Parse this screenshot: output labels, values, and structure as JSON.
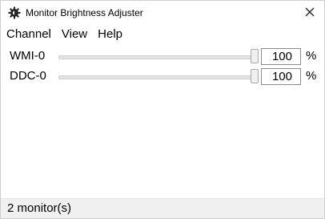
{
  "window": {
    "title": "Monitor Brightness Adjuster",
    "app_icon": "gear-icon",
    "close_icon": "close-icon"
  },
  "menu": [
    {
      "label": "Channel"
    },
    {
      "label": "View"
    },
    {
      "label": "Help"
    }
  ],
  "monitors": [
    {
      "name": "WMI-0",
      "value": "100",
      "unit": "%",
      "level": 1.0
    },
    {
      "name": "DDC-0",
      "value": "100",
      "unit": "%",
      "level": 1.0
    }
  ],
  "status": {
    "text": "2 monitor(s)"
  }
}
